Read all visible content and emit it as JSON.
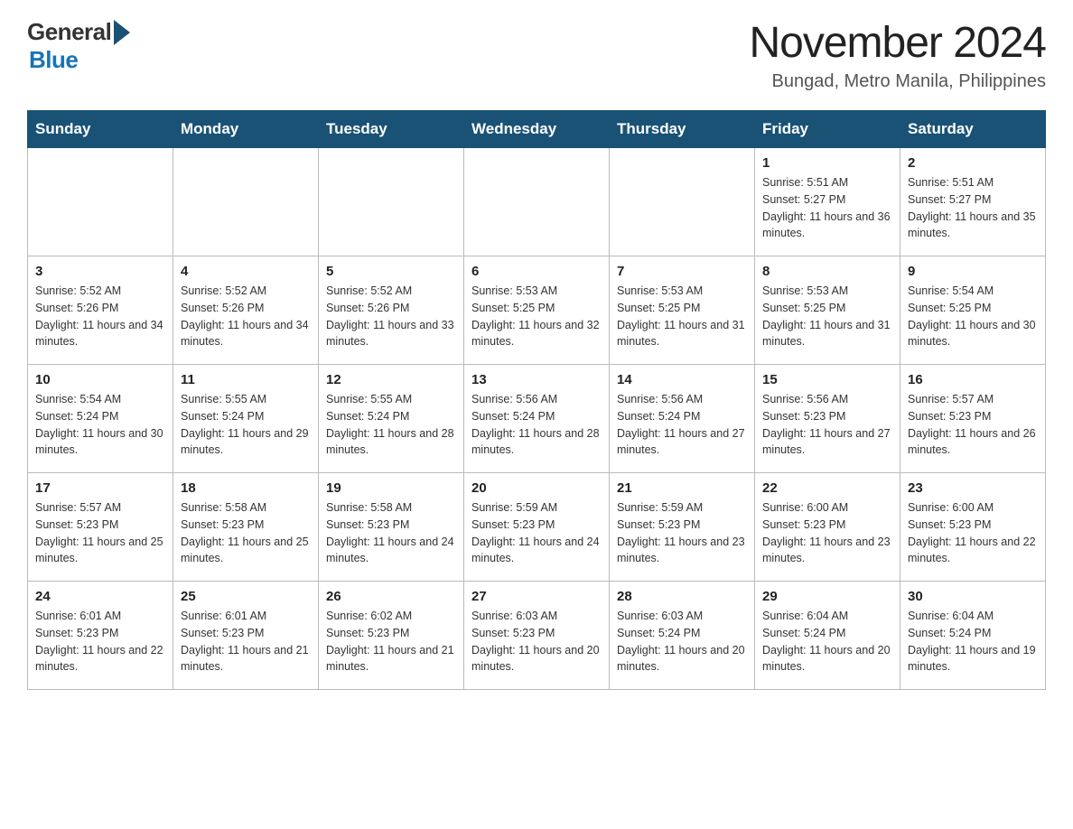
{
  "header": {
    "logo": {
      "general": "General",
      "blue": "Blue"
    },
    "title": "November 2024",
    "location": "Bungad, Metro Manila, Philippines"
  },
  "calendar": {
    "days": [
      "Sunday",
      "Monday",
      "Tuesday",
      "Wednesday",
      "Thursday",
      "Friday",
      "Saturday"
    ],
    "weeks": [
      [
        {
          "num": "",
          "info": ""
        },
        {
          "num": "",
          "info": ""
        },
        {
          "num": "",
          "info": ""
        },
        {
          "num": "",
          "info": ""
        },
        {
          "num": "",
          "info": ""
        },
        {
          "num": "1",
          "info": "Sunrise: 5:51 AM\nSunset: 5:27 PM\nDaylight: 11 hours and 36 minutes."
        },
        {
          "num": "2",
          "info": "Sunrise: 5:51 AM\nSunset: 5:27 PM\nDaylight: 11 hours and 35 minutes."
        }
      ],
      [
        {
          "num": "3",
          "info": "Sunrise: 5:52 AM\nSunset: 5:26 PM\nDaylight: 11 hours and 34 minutes."
        },
        {
          "num": "4",
          "info": "Sunrise: 5:52 AM\nSunset: 5:26 PM\nDaylight: 11 hours and 34 minutes."
        },
        {
          "num": "5",
          "info": "Sunrise: 5:52 AM\nSunset: 5:26 PM\nDaylight: 11 hours and 33 minutes."
        },
        {
          "num": "6",
          "info": "Sunrise: 5:53 AM\nSunset: 5:25 PM\nDaylight: 11 hours and 32 minutes."
        },
        {
          "num": "7",
          "info": "Sunrise: 5:53 AM\nSunset: 5:25 PM\nDaylight: 11 hours and 31 minutes."
        },
        {
          "num": "8",
          "info": "Sunrise: 5:53 AM\nSunset: 5:25 PM\nDaylight: 11 hours and 31 minutes."
        },
        {
          "num": "9",
          "info": "Sunrise: 5:54 AM\nSunset: 5:25 PM\nDaylight: 11 hours and 30 minutes."
        }
      ],
      [
        {
          "num": "10",
          "info": "Sunrise: 5:54 AM\nSunset: 5:24 PM\nDaylight: 11 hours and 30 minutes."
        },
        {
          "num": "11",
          "info": "Sunrise: 5:55 AM\nSunset: 5:24 PM\nDaylight: 11 hours and 29 minutes."
        },
        {
          "num": "12",
          "info": "Sunrise: 5:55 AM\nSunset: 5:24 PM\nDaylight: 11 hours and 28 minutes."
        },
        {
          "num": "13",
          "info": "Sunrise: 5:56 AM\nSunset: 5:24 PM\nDaylight: 11 hours and 28 minutes."
        },
        {
          "num": "14",
          "info": "Sunrise: 5:56 AM\nSunset: 5:24 PM\nDaylight: 11 hours and 27 minutes."
        },
        {
          "num": "15",
          "info": "Sunrise: 5:56 AM\nSunset: 5:23 PM\nDaylight: 11 hours and 27 minutes."
        },
        {
          "num": "16",
          "info": "Sunrise: 5:57 AM\nSunset: 5:23 PM\nDaylight: 11 hours and 26 minutes."
        }
      ],
      [
        {
          "num": "17",
          "info": "Sunrise: 5:57 AM\nSunset: 5:23 PM\nDaylight: 11 hours and 25 minutes."
        },
        {
          "num": "18",
          "info": "Sunrise: 5:58 AM\nSunset: 5:23 PM\nDaylight: 11 hours and 25 minutes."
        },
        {
          "num": "19",
          "info": "Sunrise: 5:58 AM\nSunset: 5:23 PM\nDaylight: 11 hours and 24 minutes."
        },
        {
          "num": "20",
          "info": "Sunrise: 5:59 AM\nSunset: 5:23 PM\nDaylight: 11 hours and 24 minutes."
        },
        {
          "num": "21",
          "info": "Sunrise: 5:59 AM\nSunset: 5:23 PM\nDaylight: 11 hours and 23 minutes."
        },
        {
          "num": "22",
          "info": "Sunrise: 6:00 AM\nSunset: 5:23 PM\nDaylight: 11 hours and 23 minutes."
        },
        {
          "num": "23",
          "info": "Sunrise: 6:00 AM\nSunset: 5:23 PM\nDaylight: 11 hours and 22 minutes."
        }
      ],
      [
        {
          "num": "24",
          "info": "Sunrise: 6:01 AM\nSunset: 5:23 PM\nDaylight: 11 hours and 22 minutes."
        },
        {
          "num": "25",
          "info": "Sunrise: 6:01 AM\nSunset: 5:23 PM\nDaylight: 11 hours and 21 minutes."
        },
        {
          "num": "26",
          "info": "Sunrise: 6:02 AM\nSunset: 5:23 PM\nDaylight: 11 hours and 21 minutes."
        },
        {
          "num": "27",
          "info": "Sunrise: 6:03 AM\nSunset: 5:23 PM\nDaylight: 11 hours and 20 minutes."
        },
        {
          "num": "28",
          "info": "Sunrise: 6:03 AM\nSunset: 5:24 PM\nDaylight: 11 hours and 20 minutes."
        },
        {
          "num": "29",
          "info": "Sunrise: 6:04 AM\nSunset: 5:24 PM\nDaylight: 11 hours and 20 minutes."
        },
        {
          "num": "30",
          "info": "Sunrise: 6:04 AM\nSunset: 5:24 PM\nDaylight: 11 hours and 19 minutes."
        }
      ]
    ]
  }
}
